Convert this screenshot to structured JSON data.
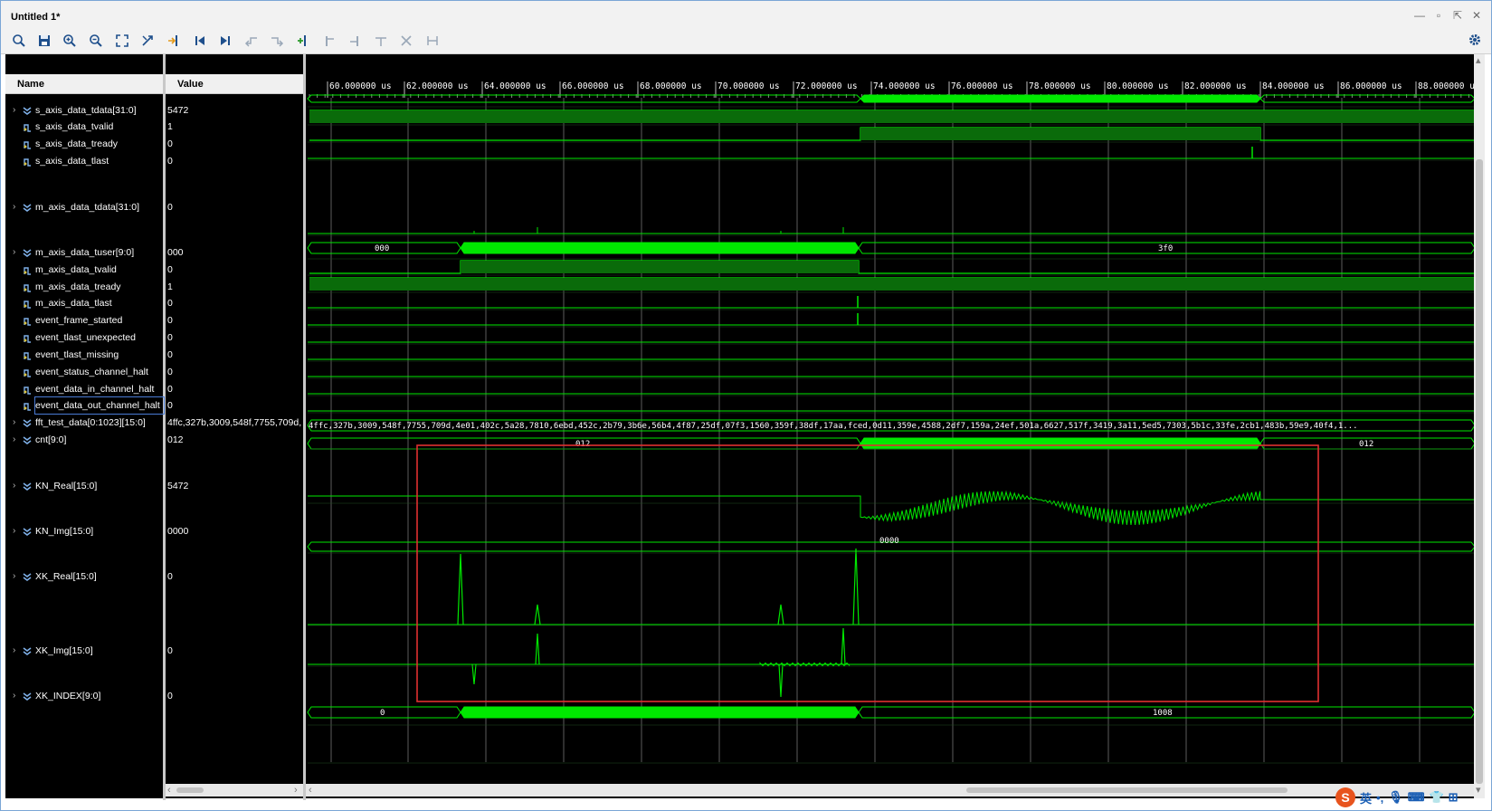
{
  "window": {
    "title": "Untitled 1*"
  },
  "headers": {
    "name": "Name",
    "value": "Value"
  },
  "toolbar": {
    "icons": [
      "search-icon",
      "save-icon",
      "zoom-in-icon",
      "zoom-out-icon",
      "zoom-fit-icon",
      "snap-icon",
      "goto-cursor-icon",
      "goto-start-icon",
      "goto-end-icon",
      "prev-transition-icon",
      "next-transition-icon",
      "add-marker-icon",
      "prev-marker-icon",
      "next-marker-icon",
      "swap-cursors-icon",
      "delete-markers-icon",
      "fixed-cursor-icon",
      "settings-gear-icon"
    ]
  },
  "time_axis": {
    "unit": "us",
    "ticks": [
      "60.000000 us",
      "62.000000 us",
      "64.000000 us",
      "66.000000 us",
      "68.000000 us",
      "70.000000 us",
      "72.000000 us",
      "74.000000 us",
      "76.000000 us",
      "78.000000 us",
      "80.000000 us",
      "82.000000 us",
      "84.000000 us",
      "86.000000 us",
      "88.000000 us"
    ]
  },
  "signals": [
    {
      "name": "s_axis_data_tdata[31:0]",
      "value": "5472",
      "type": "bus",
      "partial": true
    },
    {
      "name": "s_axis_data_tvalid",
      "value": "1",
      "type": "bit"
    },
    {
      "name": "s_axis_data_tready",
      "value": "0",
      "type": "bit"
    },
    {
      "name": "s_axis_data_tlast",
      "value": "0",
      "type": "bit"
    },
    {
      "name": "m_axis_data_tdata[31:0]",
      "value": "0",
      "type": "bus"
    },
    {
      "name": "m_axis_data_tuser[9:0]",
      "value": "000",
      "type": "bus"
    },
    {
      "name": "m_axis_data_tvalid",
      "value": "0",
      "type": "bit"
    },
    {
      "name": "m_axis_data_tready",
      "value": "1",
      "type": "bit"
    },
    {
      "name": "m_axis_data_tlast",
      "value": "0",
      "type": "bit"
    },
    {
      "name": "event_frame_started",
      "value": "0",
      "type": "bit"
    },
    {
      "name": "event_tlast_unexpected",
      "value": "0",
      "type": "bit"
    },
    {
      "name": "event_tlast_missing",
      "value": "0",
      "type": "bit"
    },
    {
      "name": "event_status_channel_halt",
      "value": "0",
      "type": "bit"
    },
    {
      "name": "event_data_in_channel_halt",
      "value": "0",
      "type": "bit"
    },
    {
      "name": "event_data_out_channel_halt",
      "value": "0",
      "type": "bit",
      "selected": true
    },
    {
      "name": "fft_test_data[0:1023][15:0]",
      "value": "4ffc,327b,3009,548f,7755,709d,",
      "type": "bus"
    },
    {
      "name": "cnt[9:0]",
      "value": "012",
      "type": "bus"
    },
    {
      "name": "KN_Real[15:0]",
      "value": "5472",
      "type": "bus"
    },
    {
      "name": "KN_Img[15:0]",
      "value": "0000",
      "type": "bus"
    },
    {
      "name": "XK_Real[15:0]",
      "value": "0",
      "type": "bus"
    },
    {
      "name": "XK_Img[15:0]",
      "value": "0",
      "type": "bus"
    },
    {
      "name": "XK_INDEX[9:0]",
      "value": "0",
      "type": "bus"
    }
  ],
  "wave_labels": {
    "tuser_left": "000",
    "tuser_right": "3f0",
    "fft_text": "4ffc,327b,3009,548f,7755,709d,4e01,402c,5a28,7810,6ebd,452c,2b79,3b6e,56b4,4f87,25df,07f3,1560,359f,38df,17aa,fced,0d11,359e,4588,2df7,159a,24ef,501a,6627,517f,3419,3a11,5ed5,7303,5b1c,33fe,2cb1,483b,59e9,40f4,1...",
    "cnt_left": "012",
    "cnt_right": "012",
    "knimg": "0000",
    "index_left": "0",
    "index_right": "1008"
  },
  "colors": {
    "wave": "#00e800",
    "wave_fill": "#0a6b0a",
    "grid": "#5c5c5c",
    "highlight_box": "#e03030",
    "background": "#000000"
  },
  "tray": {
    "ime": "英",
    "punct": "•,",
    "icons": [
      "sogou-icon",
      "mic-icon",
      "keyboard-icon",
      "skin-icon",
      "apps-icon",
      "arrow-icon"
    ]
  }
}
